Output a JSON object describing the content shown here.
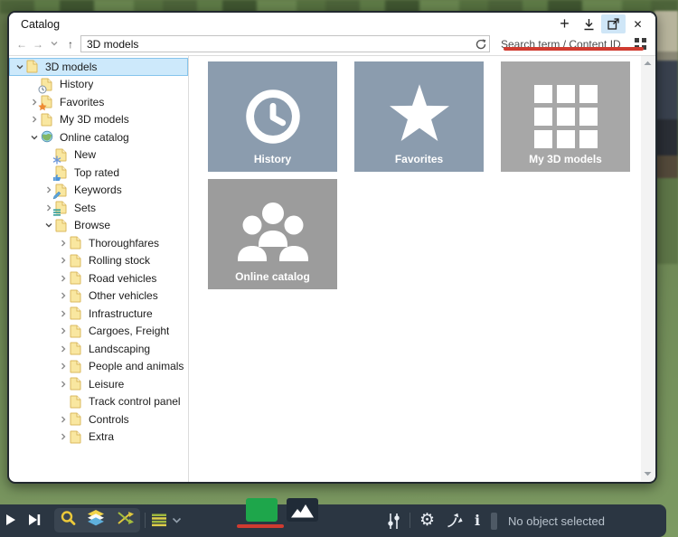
{
  "window": {
    "title": "Catalog",
    "buttons": {
      "add": "+",
      "close": "✕"
    }
  },
  "navbar": {
    "back_glyph": "←",
    "forward_glyph": "→",
    "up_glyph": "↑",
    "path_value": "3D models",
    "search_placeholder": "Search term / Content ID"
  },
  "sidebar": {
    "items": [
      {
        "label": "3D models",
        "level": 0,
        "expand": "expanded",
        "icon": "folder",
        "selected": true
      },
      {
        "label": "History",
        "level": 1,
        "expand": "none",
        "icon": "folder-clock",
        "selected": false
      },
      {
        "label": "Favorites",
        "level": 1,
        "expand": "collapsed",
        "icon": "folder-star",
        "selected": false
      },
      {
        "label": "My 3D models",
        "level": 1,
        "expand": "collapsed",
        "icon": "folder",
        "selected": false
      },
      {
        "label": "Online catalog",
        "level": 1,
        "expand": "expanded",
        "icon": "globe",
        "selected": false
      },
      {
        "label": "New",
        "level": 2,
        "expand": "none",
        "icon": "folder-new",
        "selected": false
      },
      {
        "label": "Top rated",
        "level": 2,
        "expand": "none",
        "icon": "folder-thumb",
        "selected": false
      },
      {
        "label": "Keywords",
        "level": 2,
        "expand": "collapsed",
        "icon": "folder-tag",
        "selected": false
      },
      {
        "label": "Sets",
        "level": 2,
        "expand": "collapsed",
        "icon": "folder-list",
        "selected": false
      },
      {
        "label": "Browse",
        "level": 2,
        "expand": "expanded",
        "icon": "folder",
        "selected": false
      },
      {
        "label": "Thoroughfares",
        "level": 3,
        "expand": "collapsed",
        "icon": "folder",
        "selected": false
      },
      {
        "label": "Rolling stock",
        "level": 3,
        "expand": "collapsed",
        "icon": "folder",
        "selected": false
      },
      {
        "label": "Road vehicles",
        "level": 3,
        "expand": "collapsed",
        "icon": "folder",
        "selected": false
      },
      {
        "label": "Other vehicles",
        "level": 3,
        "expand": "collapsed",
        "icon": "folder",
        "selected": false
      },
      {
        "label": "Infrastructure",
        "level": 3,
        "expand": "collapsed",
        "icon": "folder",
        "selected": false
      },
      {
        "label": "Cargoes, Freight",
        "level": 3,
        "expand": "collapsed",
        "icon": "folder",
        "selected": false
      },
      {
        "label": "Landscaping",
        "level": 3,
        "expand": "collapsed",
        "icon": "folder",
        "selected": false
      },
      {
        "label": "People and animals",
        "level": 3,
        "expand": "collapsed",
        "icon": "folder",
        "selected": false
      },
      {
        "label": "Leisure",
        "level": 3,
        "expand": "collapsed",
        "icon": "folder",
        "selected": false
      },
      {
        "label": "Track control panel",
        "level": 3,
        "expand": "none",
        "icon": "folder",
        "selected": false
      },
      {
        "label": "Controls",
        "level": 3,
        "expand": "collapsed",
        "icon": "folder",
        "selected": false
      },
      {
        "label": "Extra",
        "level": 3,
        "expand": "collapsed",
        "icon": "folder",
        "selected": false
      }
    ]
  },
  "content": {
    "tiles": [
      {
        "label": "History",
        "icon": "clock",
        "color": "#8b9cae"
      },
      {
        "label": "Favorites",
        "icon": "star",
        "color": "#8b9cae"
      },
      {
        "label": "My 3D models",
        "icon": "grid",
        "color": "#a7a7a7"
      },
      {
        "label": "Online catalog",
        "icon": "people",
        "color": "#9c9c9c"
      }
    ]
  },
  "toolbar": {
    "status_text": "No object selected"
  },
  "colors": {
    "annotation_red": "#d03b30",
    "green_button": "#1ea64b",
    "selection_bg": "#cde9fb",
    "toolbar_bg": "#2b3642"
  }
}
